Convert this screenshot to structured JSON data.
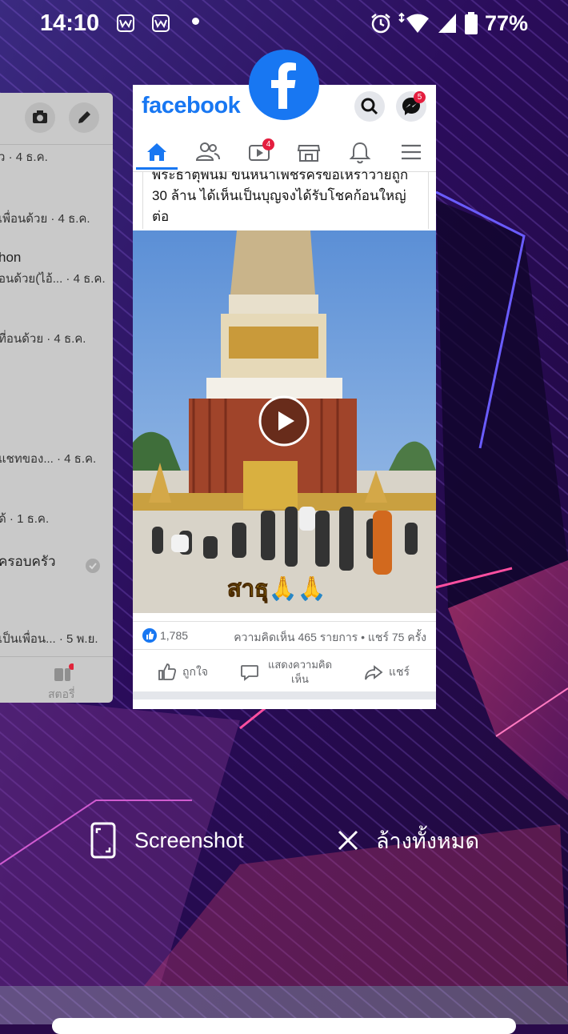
{
  "status_bar": {
    "time": "14:10",
    "notification_icons": [
      "w-app-icon",
      "w-app-icon",
      "dot"
    ],
    "right_icons": [
      "alarm-icon",
      "wifi-icon",
      "signal-icon",
      "battery-icon"
    ],
    "battery": "77%"
  },
  "recent_left_card": {
    "lines": [
      {
        "text": "ว · 4 ธ.ค."
      },
      {
        "text": "เพื่อนด้วย · 4 ธ.ค."
      },
      {
        "name": "hon",
        "text": "อนด้วย(ไอ้... · 4 ธ.ค."
      },
      {
        "text": "ที่อนด้วย · 4 ธ.ค."
      },
      {
        "text": "แชทของ... · 4 ธ.ค."
      },
      {
        "text": "ด้ · 1 ธ.ค."
      },
      {
        "name": "ครอบครัว"
      },
      {
        "text": "เป็นเพื่อน... · 5 พ.ย."
      }
    ],
    "bottom_tab": "สตอรี่"
  },
  "facebook_card": {
    "logo": "facebook",
    "messenger_badge": "5",
    "video_badge": "4",
    "post_lines": [
      "พระธาตุพนม ขนหนาเพชรครขอเหราวายถูก",
      "30 ล้าน ได้เห็นเป็นบุญจงได้รับโชคก้อนใหญ่",
      "ต่อ"
    ],
    "video_caption": "สาธุ🙏🙏",
    "like_count": "1,785",
    "engagement": "ความคิดเห็น 465 รายการ • แชร์ 75 ครั้ง",
    "actions": {
      "like": "ถูกใจ",
      "comment_line1": "แสดงความคิด",
      "comment_line2": "เห็น",
      "share": "แชร์"
    }
  },
  "recents_actions": {
    "screenshot": "Screenshot",
    "clear_all": "ล้างทั้งหมด"
  },
  "colors": {
    "facebook_blue": "#1877f2",
    "badge_red": "#e41e3f",
    "wallpaper_base": "#2a0a4a"
  }
}
